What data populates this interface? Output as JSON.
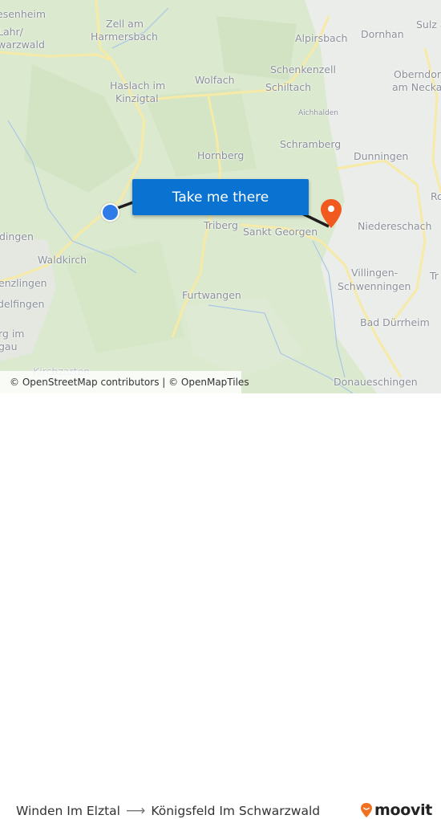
{
  "map": {
    "places": [
      {
        "name": "esenheim",
        "pos": "tl"
      },
      {
        "name": "Lahr/",
        "pos": "tl"
      },
      {
        "name": "warzwald",
        "pos": "tl"
      },
      {
        "name": "Zell am",
        "pos": "t"
      },
      {
        "name": "Harmersbach",
        "pos": "t"
      },
      {
        "name": "Haslach im",
        "pos": "t"
      },
      {
        "name": "Kinzigtal",
        "pos": "t"
      },
      {
        "name": "Wolfach",
        "pos": "t"
      },
      {
        "name": "Alpirsbach",
        "pos": "t"
      },
      {
        "name": "Dornhan",
        "pos": "t"
      },
      {
        "name": "Sulz a",
        "pos": "tr"
      },
      {
        "name": "Schenkenzell",
        "pos": "t"
      },
      {
        "name": "Schiltach",
        "pos": "t"
      },
      {
        "name": "Oberndor",
        "pos": "tr"
      },
      {
        "name": "am Necka",
        "pos": "tr"
      },
      {
        "name": "Aichhalden",
        "pos": "t"
      },
      {
        "name": "Schramberg",
        "pos": "m"
      },
      {
        "name": "Hornberg",
        "pos": "m"
      },
      {
        "name": "Dunningen",
        "pos": "m"
      },
      {
        "name": "Ro",
        "pos": "r"
      },
      {
        "name": "Triberg",
        "pos": "m"
      },
      {
        "name": "Sankt Georgen",
        "pos": "m"
      },
      {
        "name": "Niedereschach",
        "pos": "m"
      },
      {
        "name": "dingen",
        "pos": "l"
      },
      {
        "name": "Waldkirch",
        "pos": "l"
      },
      {
        "name": "enzlingen",
        "pos": "l"
      },
      {
        "name": "delfingen",
        "pos": "l"
      },
      {
        "name": "Villingen-",
        "pos": "r"
      },
      {
        "name": "Schwenningen",
        "pos": "r"
      },
      {
        "name": "Tr",
        "pos": "r"
      },
      {
        "name": "Furtwangen",
        "pos": "b"
      },
      {
        "name": "rg im",
        "pos": "bl"
      },
      {
        "name": "gau",
        "pos": "bl"
      },
      {
        "name": "Bad Dürrheim",
        "pos": "br"
      },
      {
        "name": "Kirchzarten",
        "pos": "bl"
      },
      {
        "name": "Donaueschingen",
        "pos": "br"
      }
    ],
    "cta_label": "Take me there",
    "attribution": "© OpenStreetMap contributors | © OpenMapTiles",
    "colors": {
      "cta": "#0a73d2",
      "origin": "#2f7be8",
      "destination": "#f05a1e",
      "route_line": "#1e1e1e"
    }
  },
  "footer": {
    "origin": "Winden Im Elztal",
    "destination": "Königsfeld Im Schwarzwald",
    "brand": "moovit",
    "brand_color": "#f27121"
  }
}
